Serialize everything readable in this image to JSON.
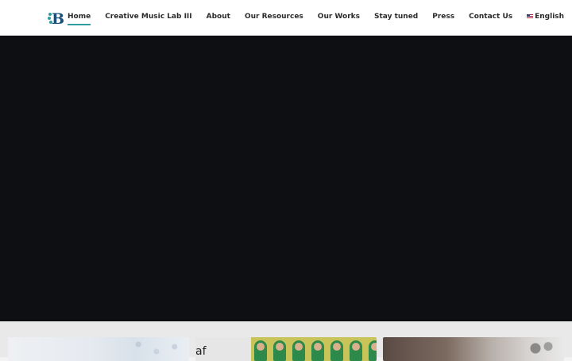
{
  "header": {
    "logo_icon": "b-logo-icon",
    "nav": [
      {
        "label": "Home",
        "active": true
      },
      {
        "label": "Creative Music Lab III",
        "active": false
      },
      {
        "label": "About",
        "active": false
      },
      {
        "label": "Our Resources",
        "active": false
      },
      {
        "label": "Our Works",
        "active": false
      },
      {
        "label": "Stay tuned",
        "active": false
      },
      {
        "label": "Press",
        "active": false
      },
      {
        "label": "Contact Us",
        "active": false
      }
    ],
    "language": {
      "label": "English",
      "icon": "us-flag-icon"
    }
  },
  "cards": {
    "card2_text": "af"
  },
  "colors": {
    "accent": "#2f9ea0",
    "hero_bg": "#0e0f12"
  }
}
